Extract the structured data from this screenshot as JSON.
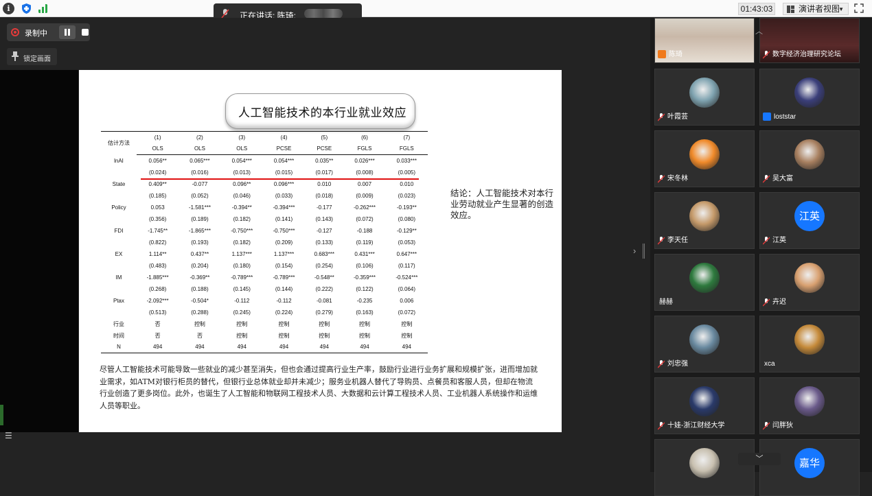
{
  "toolbar": {
    "speaker_text": "正在讲话: 陈琦;",
    "timer": "01:43:03",
    "view_label": "演讲者视图"
  },
  "recording": {
    "label": "录制中",
    "lock_label": "锁定画面"
  },
  "slide": {
    "title": "人工智能技术的本行业就业效应",
    "table": {
      "header_label": "估计方法",
      "columns": [
        "(1)",
        "(2)",
        "(3)",
        "(4)",
        "(5)",
        "(6)",
        "(7)"
      ],
      "methods": [
        "OLS",
        "OLS",
        "OLS",
        "PCSE",
        "PCSE",
        "FGLS",
        "FGLS"
      ],
      "rows": [
        {
          "label": "lnAI",
          "vals": [
            "0.056**",
            "0.065***",
            "0.054***",
            "0.054***",
            "0.035**",
            "0.026***",
            "0.033***"
          ]
        },
        {
          "label": "",
          "vals": [
            "(0.024)",
            "(0.016)",
            "(0.013)",
            "(0.015)",
            "(0.017)",
            "(0.008)",
            "(0.005)"
          ]
        },
        {
          "label": "State",
          "vals": [
            "0.409**",
            "-0.077",
            "0.096**",
            "0.096***",
            "0.010",
            "0.007",
            "0.010"
          ]
        },
        {
          "label": "",
          "vals": [
            "(0.185)",
            "(0.052)",
            "(0.046)",
            "(0.033)",
            "(0.018)",
            "(0.009)",
            "(0.023)"
          ]
        },
        {
          "label": "Policy",
          "vals": [
            "0.053",
            "-1.581***",
            "-0.394**",
            "-0.394***",
            "-0.177",
            "-0.262***",
            "-0.193**"
          ]
        },
        {
          "label": "",
          "vals": [
            "(0.356)",
            "(0.189)",
            "(0.182)",
            "(0.141)",
            "(0.143)",
            "(0.072)",
            "(0.080)"
          ]
        },
        {
          "label": "FDI",
          "vals": [
            "-1.745**",
            "-1.865***",
            "-0.750***",
            "-0.750***",
            "-0.127",
            "-0.188",
            "-0.129**"
          ]
        },
        {
          "label": "",
          "vals": [
            "(0.822)",
            "(0.193)",
            "(0.182)",
            "(0.209)",
            "(0.133)",
            "(0.119)",
            "(0.053)"
          ]
        },
        {
          "label": "EX",
          "vals": [
            "1.114**",
            "0.437**",
            "1.137***",
            "1.137***",
            "0.683***",
            "0.431***",
            "0.647***"
          ]
        },
        {
          "label": "",
          "vals": [
            "(0.483)",
            "(0.204)",
            "(0.180)",
            "(0.154)",
            "(0.254)",
            "(0.106)",
            "(0.117)"
          ]
        },
        {
          "label": "IM",
          "vals": [
            "-1.885***",
            "-0.369**",
            "-0.789***",
            "-0.789***",
            "-0.548**",
            "-0.359***",
            "-0.524***"
          ]
        },
        {
          "label": "",
          "vals": [
            "(0.268)",
            "(0.188)",
            "(0.145)",
            "(0.144)",
            "(0.222)",
            "(0.122)",
            "(0.064)"
          ]
        },
        {
          "label": "Ptax",
          "vals": [
            "-2.092***",
            "-0.504*",
            "-0.112",
            "-0.112",
            "-0.081",
            "-0.235",
            "0.006"
          ]
        },
        {
          "label": "",
          "vals": [
            "(0.513)",
            "(0.288)",
            "(0.245)",
            "(0.224)",
            "(0.279)",
            "(0.163)",
            "(0.072)"
          ]
        },
        {
          "label": "行业",
          "vals": [
            "否",
            "控制",
            "控制",
            "控制",
            "控制",
            "控制",
            "控制"
          ]
        },
        {
          "label": "时间",
          "vals": [
            "否",
            "否",
            "控制",
            "控制",
            "控制",
            "控制",
            "控制"
          ]
        },
        {
          "label": "N",
          "vals": [
            "494",
            "494",
            "494",
            "494",
            "494",
            "494",
            "494"
          ]
        }
      ]
    },
    "conclusion": "结论：人工智能技术对本行业劳动就业产生显著的创造效应。",
    "paragraph": "尽管人工智能技术可能导致一些就业的减少甚至消失，但也会通过提高行业生产率，鼓励行业进行业务扩展和规模扩张，进而增加就业需求，如ATM对银行柜员的替代，但银行业总体就业却并未减少；服务业机器人替代了导购员、点餐员和客服人员，但却在物流行业创造了更多岗位。此外，也诞生了人工智能和物联网工程技术人员、大数据和云计算工程技术人员、工业机器人系统操作和运维人员等职业。"
  },
  "participants": [
    {
      "name": "陈琦",
      "avatar": "photo-woman",
      "icon": "orange-user",
      "color": "#f07a1c"
    },
    {
      "name": "数字经济治理研究论坛",
      "avatar": "dark-banner",
      "icon": "mic-off",
      "color": "#4a2a2a"
    },
    {
      "name": "叶霞芸",
      "avatar": "wave-photo",
      "icon": "mic-off",
      "color": "#7fa3b0"
    },
    {
      "name": "loststar",
      "avatar": "anime-photo",
      "icon": "blue-user",
      "color": "#3b3f7a"
    },
    {
      "name": "宋冬林",
      "avatar": "sunset-photo",
      "icon": "mic-off",
      "color": "#f08a2a"
    },
    {
      "name": "吴大富",
      "avatar": "portrait-photo",
      "icon": "mic-off",
      "color": "#a88060"
    },
    {
      "name": "李天任",
      "avatar": "painting-photo",
      "icon": "mic-off",
      "color": "#c59a6a"
    },
    {
      "name": "江英",
      "avatar": "text-avatar",
      "avatar_text": "江英",
      "icon": "mic-off",
      "color": "#1677ff"
    },
    {
      "name": "赫赫",
      "avatar": "green-photo",
      "icon": "none",
      "color": "#2e7a3e"
    },
    {
      "name": "卉迟",
      "avatar": "cartoon-photo",
      "icon": "mic-off",
      "color": "#d8a070"
    },
    {
      "name": "刘忠强",
      "avatar": "park-photo",
      "icon": "mic-off",
      "color": "#6a8aa0"
    },
    {
      "name": "xca",
      "avatar": "tree-photo",
      "icon": "none",
      "color": "#c58a3a"
    },
    {
      "name": "十娃-浙江财经大学",
      "avatar": "night-photo",
      "icon": "mic-off",
      "color": "#2a3a6a"
    },
    {
      "name": "闫胖狄",
      "avatar": "purple-photo",
      "icon": "mic-off",
      "color": "#6a5a8a"
    },
    {
      "name": "",
      "avatar": "panda-photo",
      "icon": "none",
      "color": "#c8c0b0"
    },
    {
      "name": "",
      "avatar": "text-avatar",
      "avatar_text": "嘉华",
      "icon": "none",
      "color": "#1677ff"
    }
  ]
}
